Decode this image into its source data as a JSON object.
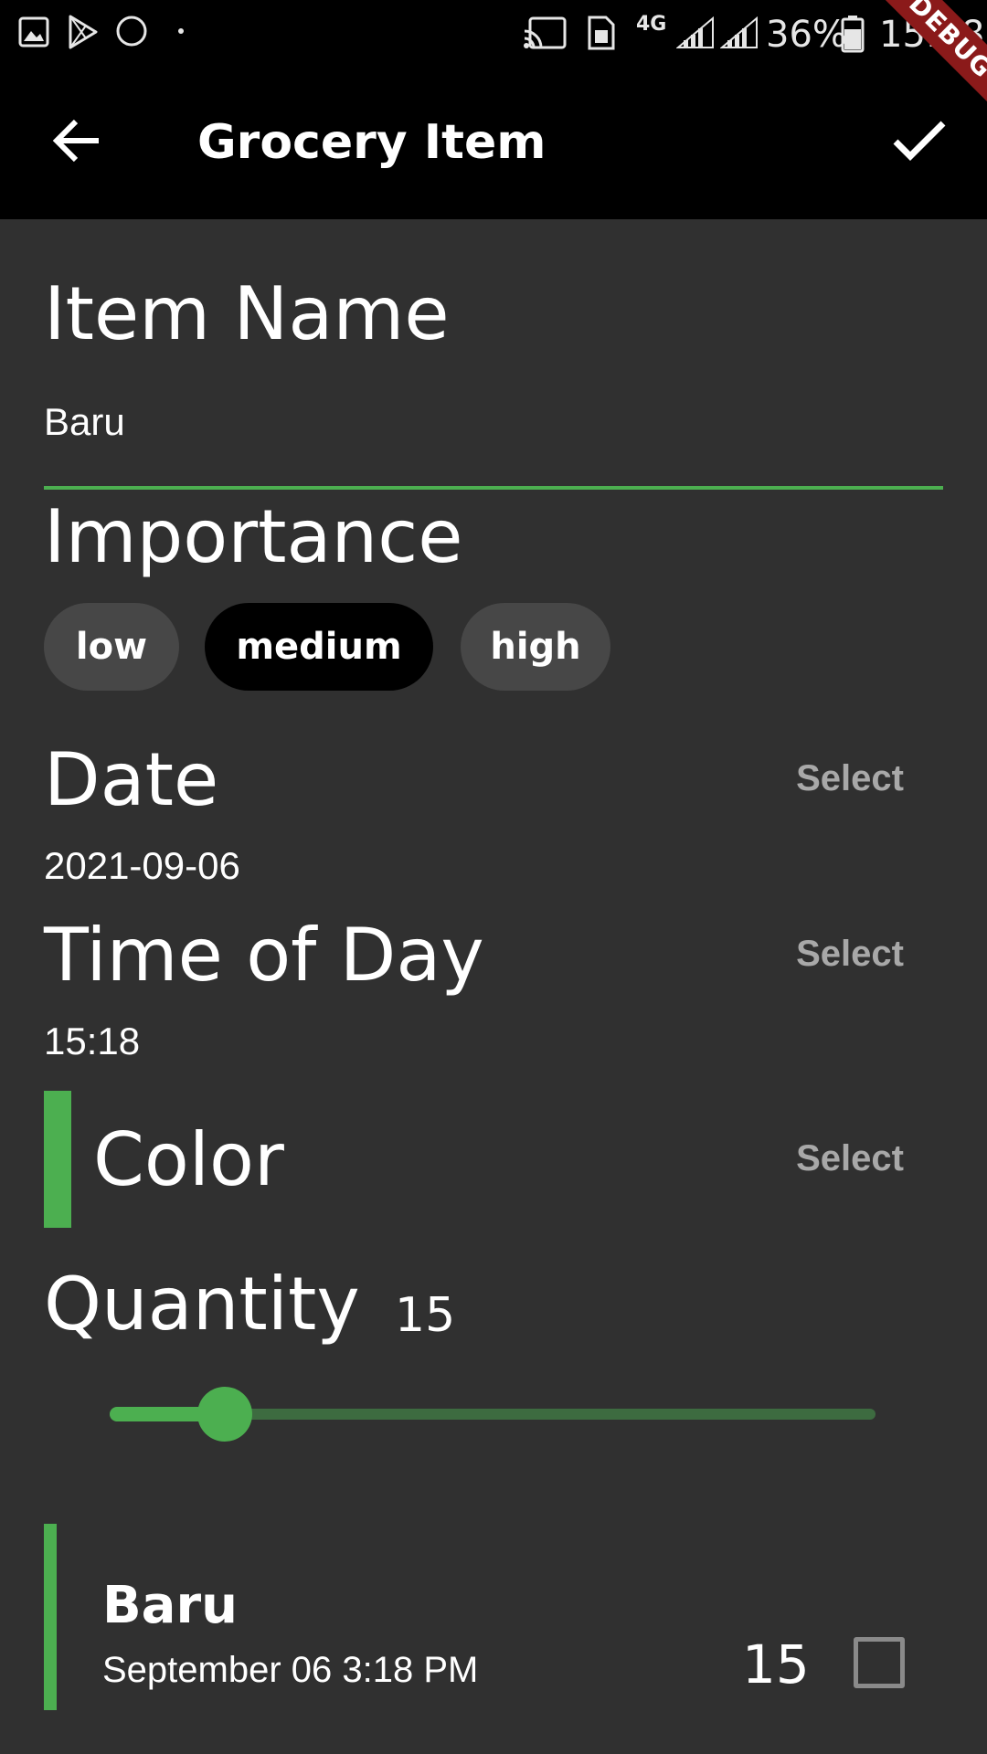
{
  "status_bar": {
    "battery_percent": "36%",
    "time": "15:18",
    "network": "4G",
    "icons": [
      "gallery-icon",
      "play-store-icon",
      "circle-icon",
      "dot-icon",
      "cast-icon",
      "sim-icon",
      "network-4g-icon",
      "signal-icon",
      "signal-icon",
      "battery-icon"
    ]
  },
  "debug_banner": {
    "label": "DEBUG"
  },
  "app_bar": {
    "title": "Grocery Item",
    "back_icon": "arrow-back-icon",
    "confirm_icon": "check-icon"
  },
  "form": {
    "item_name": {
      "label": "Item Name",
      "value": "Baru"
    },
    "importance": {
      "label": "Importance",
      "options": [
        "low",
        "medium",
        "high"
      ],
      "selected": "medium"
    },
    "date": {
      "label": "Date",
      "value": "2021-09-06",
      "select_label": "Select"
    },
    "time_of_day": {
      "label": "Time of Day",
      "value": "15:18",
      "select_label": "Select"
    },
    "color": {
      "label": "Color",
      "value": "#4caf50",
      "select_label": "Select"
    },
    "quantity": {
      "label": "Quantity",
      "value": "15",
      "slider_fraction": 0.15
    }
  },
  "preview": {
    "name": "Baru",
    "date": "September 06 3:18 PM",
    "quantity": "15",
    "checked": false
  },
  "colors": {
    "accent": "#4caf50",
    "background": "#303030",
    "app_bar": "#000000",
    "chip": "#474747",
    "chip_selected": "#000000",
    "select_text": "#a8a8a8"
  }
}
